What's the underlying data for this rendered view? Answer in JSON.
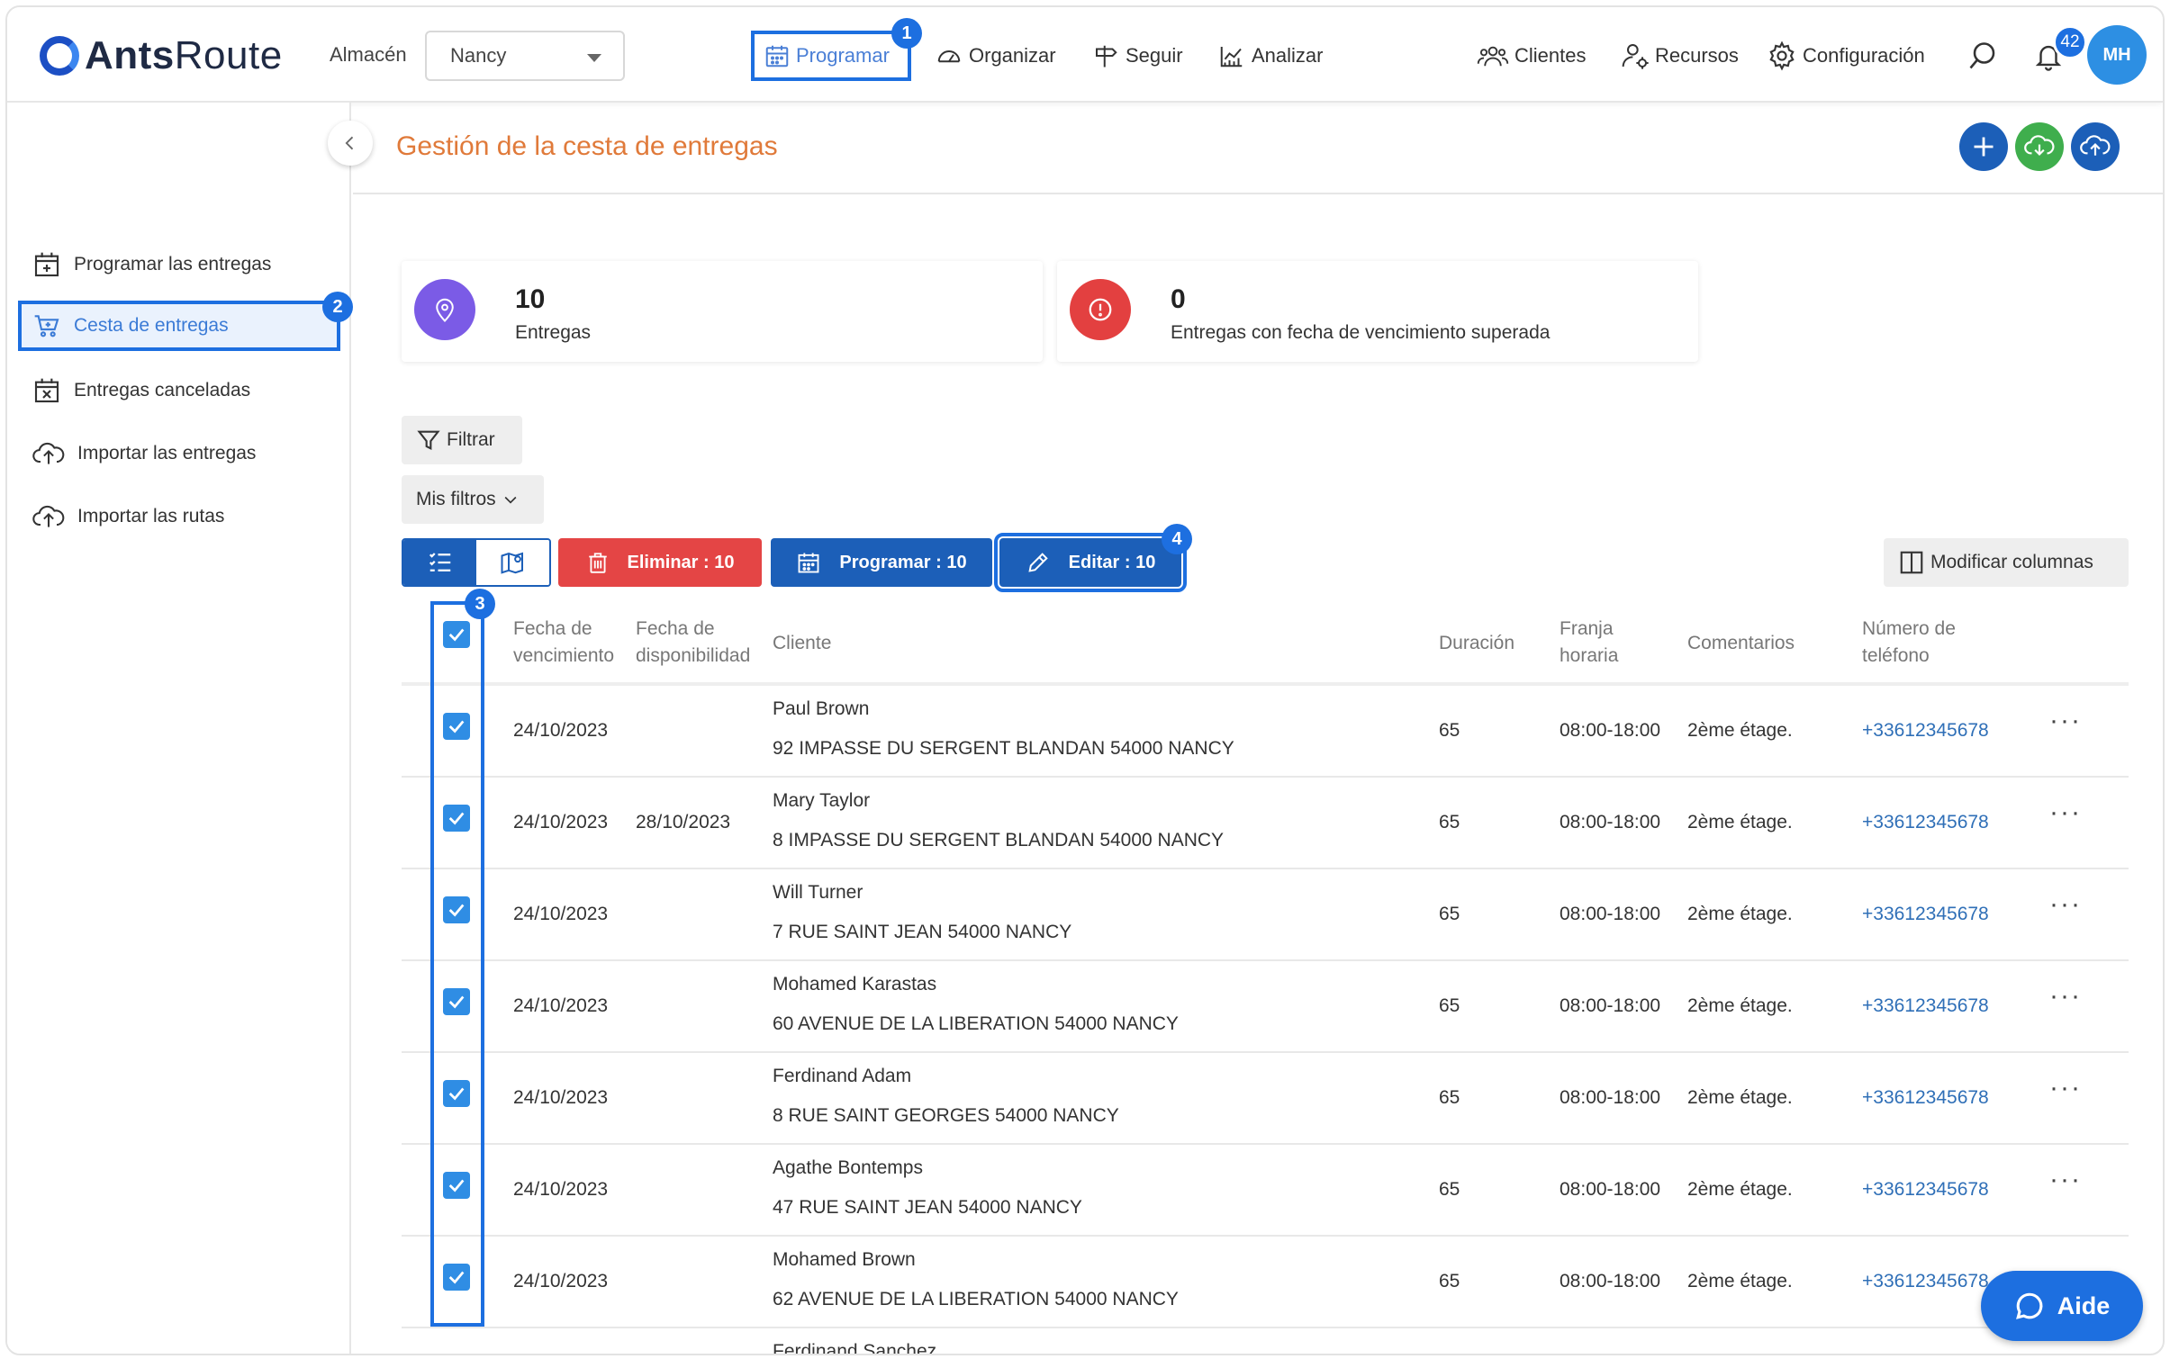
{
  "app": {
    "logo_bold": "Ants",
    "logo_rest": "Route"
  },
  "header": {
    "warehouse_label": "Almacén",
    "warehouse_value": "Nancy",
    "nav": [
      {
        "label": "Programar",
        "badge": "1"
      },
      {
        "label": "Organizar"
      },
      {
        "label": "Seguir"
      },
      {
        "label": "Analizar"
      },
      {
        "label": "Clientes"
      },
      {
        "label": "Recursos"
      },
      {
        "label": "Configuración"
      }
    ],
    "notification_count": "42",
    "avatar_initials": "MH"
  },
  "sidebar": {
    "items": [
      {
        "label": "Programar las entregas"
      },
      {
        "label": "Cesta de entregas",
        "badge": "2"
      },
      {
        "label": "Entregas canceladas"
      },
      {
        "label": "Importar las entregas"
      },
      {
        "label": "Importar las rutas"
      }
    ]
  },
  "main": {
    "title": "Gestión de la cesta de entregas",
    "stats": [
      {
        "value": "10",
        "label": "Entregas",
        "color": "#7b5be6"
      },
      {
        "value": "0",
        "label": "Entregas con fecha de vencimiento superada",
        "color": "#e34040"
      }
    ],
    "filter_label": "Filtrar",
    "my_filters_label": "Mis filtros",
    "actions": {
      "delete": "Eliminar : 10",
      "schedule": "Programar : 10",
      "edit": "Editar : 10",
      "edit_badge": "4",
      "modify_columns": "Modificar columnas",
      "select_badge": "3"
    },
    "columns": {
      "due_1": "Fecha de",
      "due_2": "vencimiento",
      "avail_1": "Fecha de",
      "avail_2": "disponibilidad",
      "client": "Cliente",
      "duration": "Duración",
      "slot_1": "Franja",
      "slot_2": "horaria",
      "comments": "Comentarios",
      "phone_1": "Número de",
      "phone_2": "teléfono"
    },
    "rows": [
      {
        "due": "24/10/2023",
        "avail": "",
        "name": "Paul Brown",
        "address": "92 IMPASSE DU SERGENT BLANDAN 54000 NANCY",
        "duration": "65",
        "slot": "08:00-18:00",
        "comment": "2ème étage.",
        "phone": "+33612345678"
      },
      {
        "due": "24/10/2023",
        "avail": "28/10/2023",
        "name": "Mary Taylor",
        "address": "8 IMPASSE DU SERGENT BLANDAN 54000 NANCY",
        "duration": "65",
        "slot": "08:00-18:00",
        "comment": "2ème étage.",
        "phone": "+33612345678"
      },
      {
        "due": "24/10/2023",
        "avail": "",
        "name": "Will Turner",
        "address": "7 RUE SAINT JEAN 54000 NANCY",
        "duration": "65",
        "slot": "08:00-18:00",
        "comment": "2ème étage.",
        "phone": "+33612345678"
      },
      {
        "due": "24/10/2023",
        "avail": "",
        "name": "Mohamed Karastas",
        "address": "60 AVENUE DE LA LIBERATION 54000 NANCY",
        "duration": "65",
        "slot": "08:00-18:00",
        "comment": "2ème étage.",
        "phone": "+33612345678"
      },
      {
        "due": "24/10/2023",
        "avail": "",
        "name": "Ferdinand Adam",
        "address": "8 RUE SAINT GEORGES 54000 NANCY",
        "duration": "65",
        "slot": "08:00-18:00",
        "comment": "2ème étage.",
        "phone": "+33612345678"
      },
      {
        "due": "24/10/2023",
        "avail": "",
        "name": "Agathe Bontemps",
        "address": "47 RUE SAINT JEAN 54000 NANCY",
        "duration": "65",
        "slot": "08:00-18:00",
        "comment": "2ème étage.",
        "phone": "+33612345678"
      },
      {
        "due": "24/10/2023",
        "avail": "",
        "name": "Mohamed Brown",
        "address": "62 AVENUE DE LA LIBERATION 54000 NANCY",
        "duration": "65",
        "slot": "08:00-18:00",
        "comment": "2ème étage.",
        "phone": "+33612345678"
      },
      {
        "due": "",
        "avail": "",
        "name": "Ferdinand Sanchez",
        "address": "",
        "duration": "",
        "slot": "",
        "comment": "",
        "phone": ""
      }
    ]
  },
  "help": {
    "label": "Aide"
  },
  "icons": [
    "calendar-icon",
    "speedometer-icon",
    "signpost-icon",
    "chart-icon",
    "users-icon",
    "user-gear-icon",
    "gear-icon",
    "search-icon",
    "bell-icon",
    "cart-icon",
    "calendar-x-icon",
    "cloud-upload-icon",
    "pin-icon",
    "alert-icon",
    "filter-icon",
    "list-icon",
    "map-icon",
    "trash-icon",
    "pencil-icon",
    "columns-icon",
    "chat-icon",
    "plus-icon"
  ]
}
